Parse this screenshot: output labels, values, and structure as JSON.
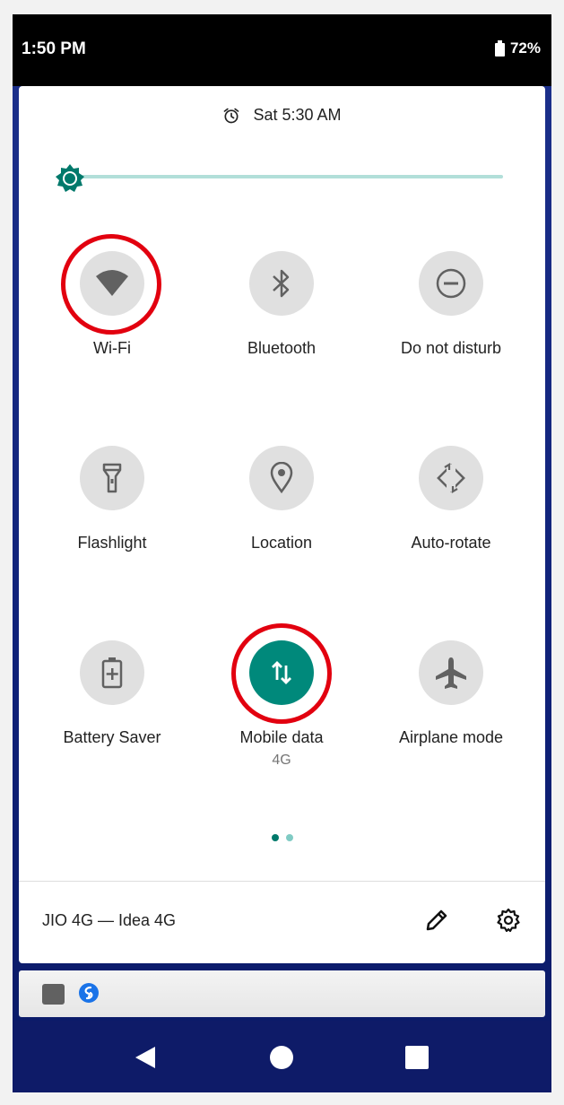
{
  "status_bar": {
    "time": "1:50 PM",
    "battery": "72%"
  },
  "alarm": {
    "text": "Sat 5:30 AM"
  },
  "tiles": [
    {
      "label": "Wi-Fi",
      "icon": "wifi-icon"
    },
    {
      "label": "Bluetooth",
      "icon": "bluetooth-icon"
    },
    {
      "label": "Do not disturb",
      "icon": "do-not-disturb-icon"
    },
    {
      "label": "Flashlight",
      "icon": "flashlight-icon"
    },
    {
      "label": "Location",
      "icon": "location-icon"
    },
    {
      "label": "Auto-rotate",
      "icon": "auto-rotate-icon"
    },
    {
      "label": "Battery Saver",
      "icon": "battery-saver-icon"
    },
    {
      "label": "Mobile data",
      "sub": "4G",
      "icon": "mobile-data-icon",
      "active": true
    },
    {
      "label": "Airplane mode",
      "icon": "airplane-icon"
    }
  ],
  "footer": {
    "carrier": "JIO 4G — Idea 4G"
  },
  "colors": {
    "accent": "#00897b",
    "highlight_ring": "#e2000f",
    "tile_bg": "#e0e0e0"
  }
}
